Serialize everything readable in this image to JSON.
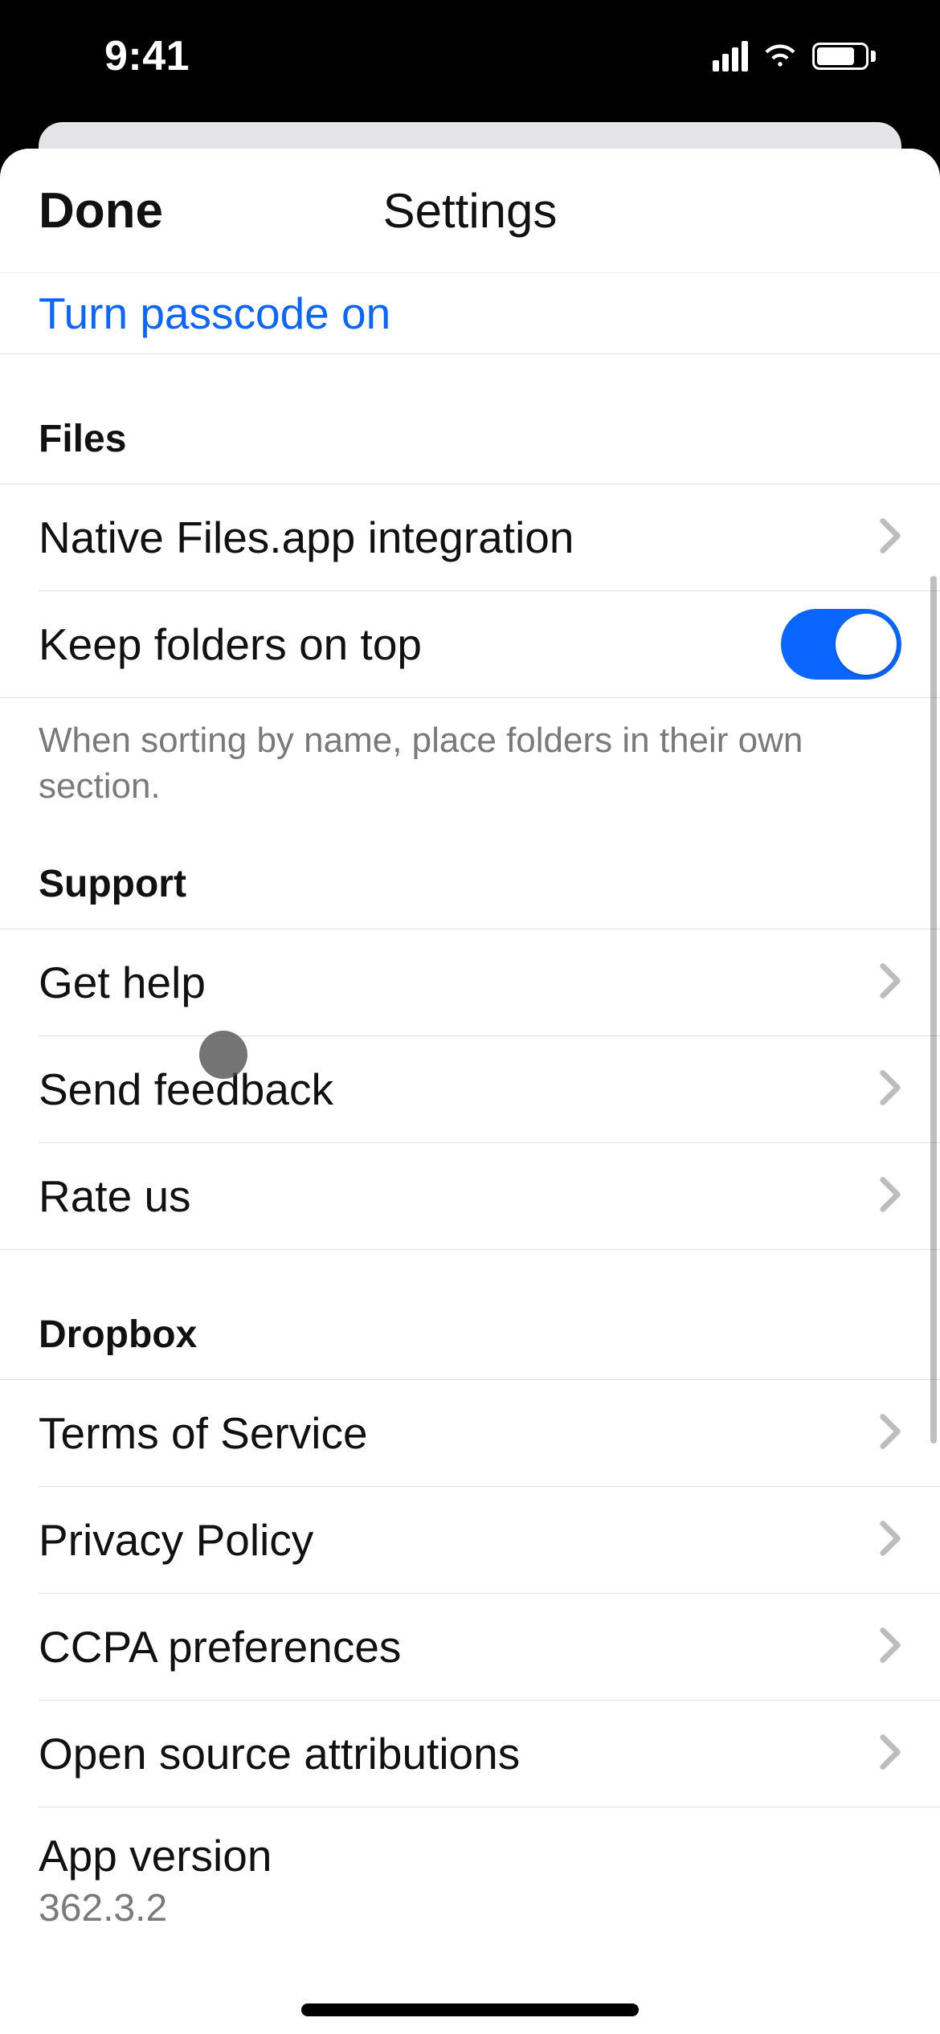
{
  "status": {
    "time": "9:41"
  },
  "nav": {
    "done": "Done",
    "title": "Settings"
  },
  "passcode": {
    "turn_on": "Turn passcode on"
  },
  "files": {
    "header": "Files",
    "native": "Native Files.app integration",
    "keep_top": "Keep folders on top",
    "keep_top_on": true,
    "footer": "When sorting by name, place folders in their own section."
  },
  "support": {
    "header": "Support",
    "get_help": "Get help",
    "send_feedback": "Send feedback",
    "rate_us": "Rate us"
  },
  "dropbox": {
    "header": "Dropbox",
    "tos": "Terms of Service",
    "privacy": "Privacy Policy",
    "ccpa": "CCPA preferences",
    "open_source": "Open source attributions",
    "app_version_label": "App version",
    "app_version_value": "362.3.2"
  }
}
